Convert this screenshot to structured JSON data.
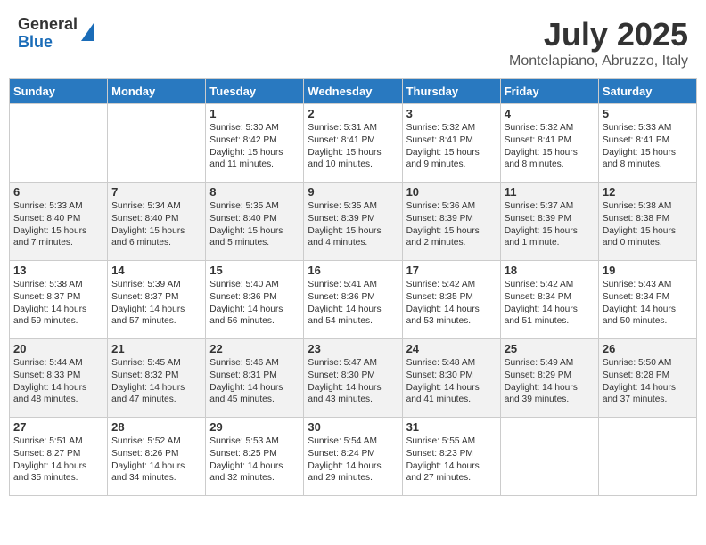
{
  "header": {
    "logo_general": "General",
    "logo_blue": "Blue",
    "main_title": "July 2025",
    "subtitle": "Montelapiano, Abruzzo, Italy"
  },
  "days_of_week": [
    "Sunday",
    "Monday",
    "Tuesday",
    "Wednesday",
    "Thursday",
    "Friday",
    "Saturday"
  ],
  "weeks": [
    [
      {
        "day": "",
        "info": ""
      },
      {
        "day": "",
        "info": ""
      },
      {
        "day": "1",
        "info": "Sunrise: 5:30 AM\nSunset: 8:42 PM\nDaylight: 15 hours\nand 11 minutes."
      },
      {
        "day": "2",
        "info": "Sunrise: 5:31 AM\nSunset: 8:41 PM\nDaylight: 15 hours\nand 10 minutes."
      },
      {
        "day": "3",
        "info": "Sunrise: 5:32 AM\nSunset: 8:41 PM\nDaylight: 15 hours\nand 9 minutes."
      },
      {
        "day": "4",
        "info": "Sunrise: 5:32 AM\nSunset: 8:41 PM\nDaylight: 15 hours\nand 8 minutes."
      },
      {
        "day": "5",
        "info": "Sunrise: 5:33 AM\nSunset: 8:41 PM\nDaylight: 15 hours\nand 8 minutes."
      }
    ],
    [
      {
        "day": "6",
        "info": "Sunrise: 5:33 AM\nSunset: 8:40 PM\nDaylight: 15 hours\nand 7 minutes."
      },
      {
        "day": "7",
        "info": "Sunrise: 5:34 AM\nSunset: 8:40 PM\nDaylight: 15 hours\nand 6 minutes."
      },
      {
        "day": "8",
        "info": "Sunrise: 5:35 AM\nSunset: 8:40 PM\nDaylight: 15 hours\nand 5 minutes."
      },
      {
        "day": "9",
        "info": "Sunrise: 5:35 AM\nSunset: 8:39 PM\nDaylight: 15 hours\nand 4 minutes."
      },
      {
        "day": "10",
        "info": "Sunrise: 5:36 AM\nSunset: 8:39 PM\nDaylight: 15 hours\nand 2 minutes."
      },
      {
        "day": "11",
        "info": "Sunrise: 5:37 AM\nSunset: 8:39 PM\nDaylight: 15 hours\nand 1 minute."
      },
      {
        "day": "12",
        "info": "Sunrise: 5:38 AM\nSunset: 8:38 PM\nDaylight: 15 hours\nand 0 minutes."
      }
    ],
    [
      {
        "day": "13",
        "info": "Sunrise: 5:38 AM\nSunset: 8:37 PM\nDaylight: 14 hours\nand 59 minutes."
      },
      {
        "day": "14",
        "info": "Sunrise: 5:39 AM\nSunset: 8:37 PM\nDaylight: 14 hours\nand 57 minutes."
      },
      {
        "day": "15",
        "info": "Sunrise: 5:40 AM\nSunset: 8:36 PM\nDaylight: 14 hours\nand 56 minutes."
      },
      {
        "day": "16",
        "info": "Sunrise: 5:41 AM\nSunset: 8:36 PM\nDaylight: 14 hours\nand 54 minutes."
      },
      {
        "day": "17",
        "info": "Sunrise: 5:42 AM\nSunset: 8:35 PM\nDaylight: 14 hours\nand 53 minutes."
      },
      {
        "day": "18",
        "info": "Sunrise: 5:42 AM\nSunset: 8:34 PM\nDaylight: 14 hours\nand 51 minutes."
      },
      {
        "day": "19",
        "info": "Sunrise: 5:43 AM\nSunset: 8:34 PM\nDaylight: 14 hours\nand 50 minutes."
      }
    ],
    [
      {
        "day": "20",
        "info": "Sunrise: 5:44 AM\nSunset: 8:33 PM\nDaylight: 14 hours\nand 48 minutes."
      },
      {
        "day": "21",
        "info": "Sunrise: 5:45 AM\nSunset: 8:32 PM\nDaylight: 14 hours\nand 47 minutes."
      },
      {
        "day": "22",
        "info": "Sunrise: 5:46 AM\nSunset: 8:31 PM\nDaylight: 14 hours\nand 45 minutes."
      },
      {
        "day": "23",
        "info": "Sunrise: 5:47 AM\nSunset: 8:30 PM\nDaylight: 14 hours\nand 43 minutes."
      },
      {
        "day": "24",
        "info": "Sunrise: 5:48 AM\nSunset: 8:30 PM\nDaylight: 14 hours\nand 41 minutes."
      },
      {
        "day": "25",
        "info": "Sunrise: 5:49 AM\nSunset: 8:29 PM\nDaylight: 14 hours\nand 39 minutes."
      },
      {
        "day": "26",
        "info": "Sunrise: 5:50 AM\nSunset: 8:28 PM\nDaylight: 14 hours\nand 37 minutes."
      }
    ],
    [
      {
        "day": "27",
        "info": "Sunrise: 5:51 AM\nSunset: 8:27 PM\nDaylight: 14 hours\nand 35 minutes."
      },
      {
        "day": "28",
        "info": "Sunrise: 5:52 AM\nSunset: 8:26 PM\nDaylight: 14 hours\nand 34 minutes."
      },
      {
        "day": "29",
        "info": "Sunrise: 5:53 AM\nSunset: 8:25 PM\nDaylight: 14 hours\nand 32 minutes."
      },
      {
        "day": "30",
        "info": "Sunrise: 5:54 AM\nSunset: 8:24 PM\nDaylight: 14 hours\nand 29 minutes."
      },
      {
        "day": "31",
        "info": "Sunrise: 5:55 AM\nSunset: 8:23 PM\nDaylight: 14 hours\nand 27 minutes."
      },
      {
        "day": "",
        "info": ""
      },
      {
        "day": "",
        "info": ""
      }
    ]
  ]
}
